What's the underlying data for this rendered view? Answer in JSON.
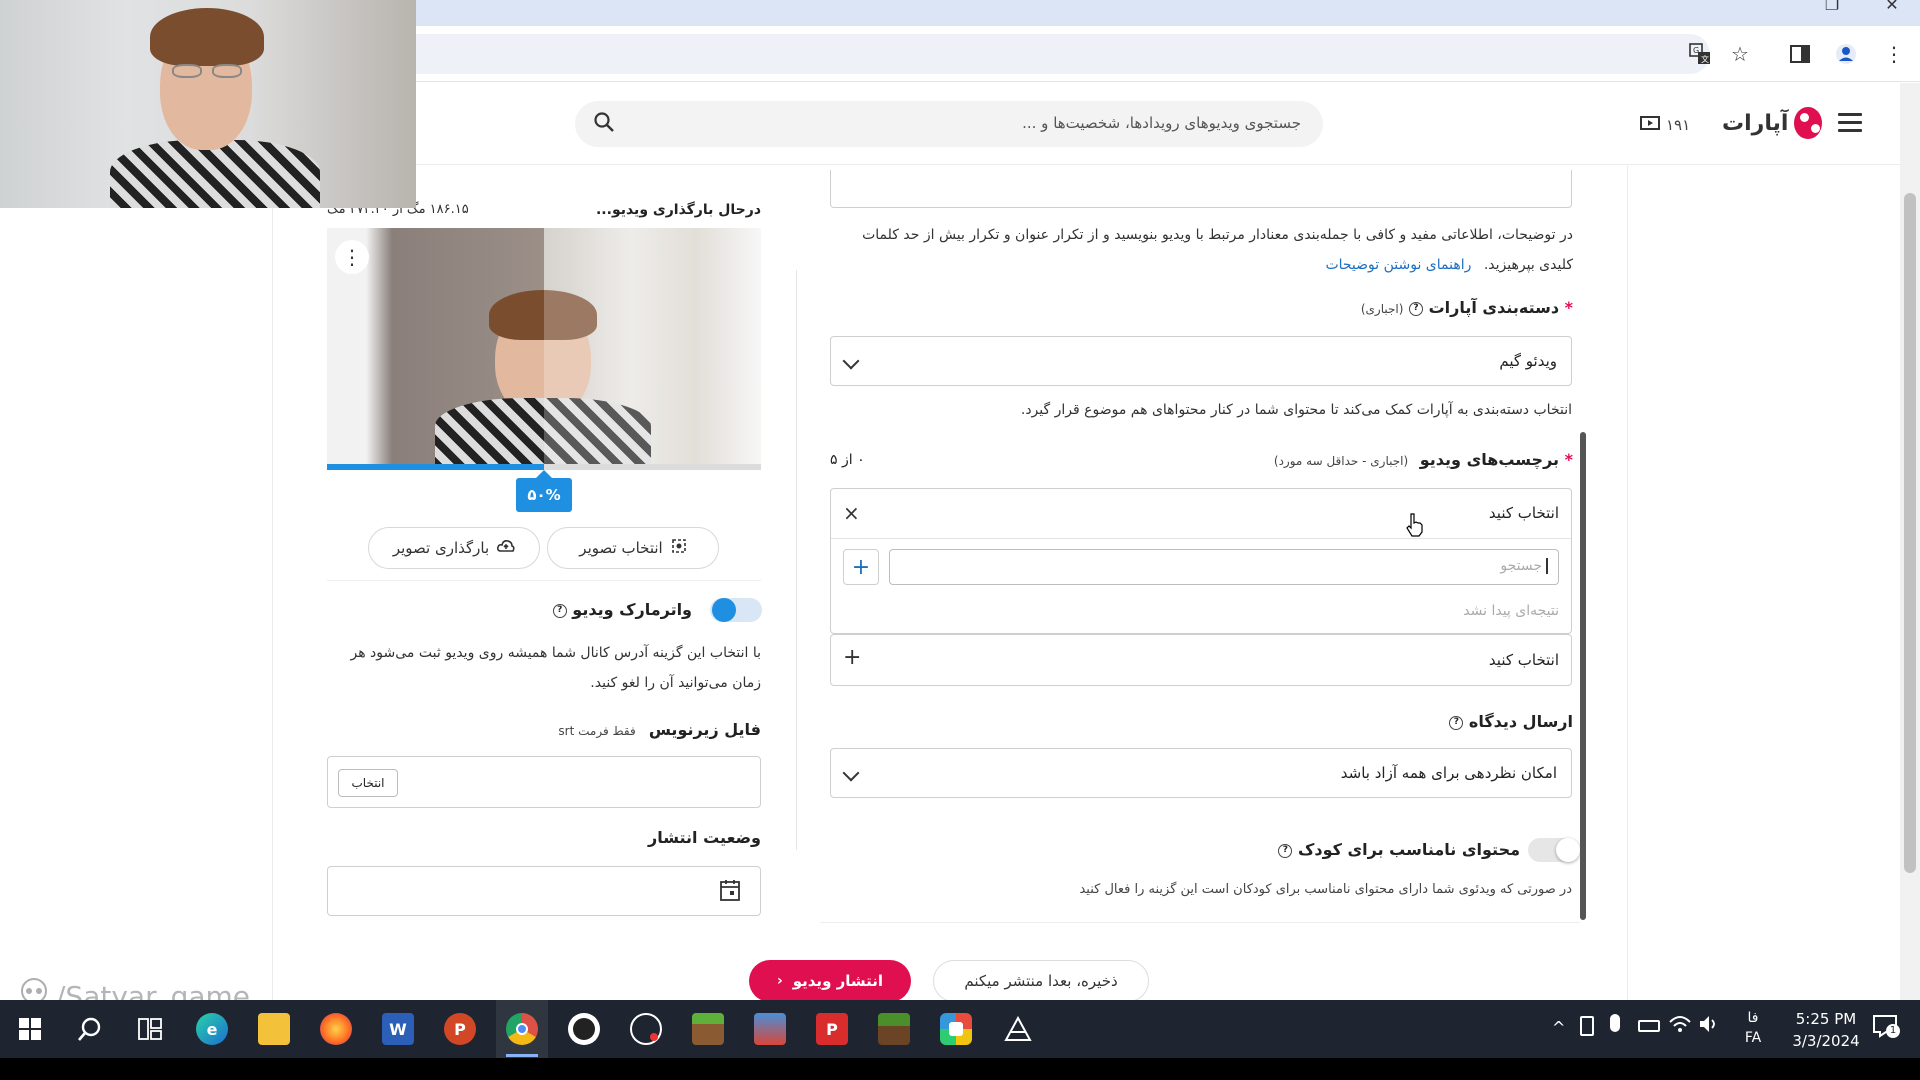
{
  "browser": {
    "icons": [
      "translate-icon",
      "bookmark-star-icon",
      "side-panel-icon",
      "profile-icon",
      "kebab-menu-icon"
    ]
  },
  "header": {
    "logo_text": "آپارات",
    "video_count": "۱۹۱",
    "search_placeholder": "جستجوی ویدیوهای رویدادها، شخصیت‌ها و ..."
  },
  "form": {
    "description_help": "در توضیحات، اطلاعاتی مفید و کافی با جمله‌بندی معنادار مرتبط با ویدیو بنویسید و از تکرار عنوان و تکرار بیش از حد کلمات کلیدی بپرهیزید.",
    "description_help_link": "راهنمای نوشتن توضیحات",
    "category": {
      "label": "دسته‌بندی آپارات",
      "required_note": "(اجباری)",
      "value": "ویدئو گیم",
      "help": "انتخاب دسته‌بندی به آپارات کمک می‌کند تا محتوای شما در کنار محتواهای هم موضوع قرار گیرد."
    },
    "tags": {
      "label": "برچسب‌های ویدیو",
      "required_note": "(اجباری - حداقل سه مورد)",
      "counter": "۰ از ۵",
      "select_placeholder": "انتخاب کنید",
      "search_placeholder": "جستجو",
      "no_result": "نتیجه‌ای پیدا نشد",
      "second_select": "انتخاب کنید"
    },
    "comments": {
      "label": "ارسال دیدگاه",
      "value": "امکان نظردهی برای همه آزاد باشد"
    },
    "kids": {
      "label": "محتوای نامناسب برای کودک",
      "help": "در صورتی که ویدئوی شما دارای محتوای نامناسب برای کودکان است این گزینه را فعال کنید"
    }
  },
  "upload": {
    "status": "درحال بارگذاری ویدیو...",
    "size": "۱۸۶.۱۵ مگ از ۳۷۲.۳۰ مگ",
    "progress": 0.5,
    "progress_label": "۵۰%",
    "select_image": "انتخاب تصویر",
    "upload_image": "بارگذاری تصویر",
    "watermark_label": "واترمارک ویدیو",
    "watermark_on": true,
    "watermark_help": "با انتخاب این گزینه آدرس کانال شما همیشه روی ویدیو ثبت می‌شود هر زمان می‌توانید آن را لغو کنید.",
    "subtitle_label": "فایل زیرنویس",
    "subtitle_note": "فقط فرمت srt",
    "subtitle_choose": "انتخاب",
    "publish_status_label": "وضعیت انتشار"
  },
  "actions": {
    "publish": "انتشار ویدیو",
    "save_later": "ذخیره، بعدا منتشر میکنم"
  },
  "watermark_overlay": "/Satyar_game",
  "taskbar": {
    "apps": [
      "windows-start-icon",
      "search-icon",
      "task-view-icon",
      "edge-icon",
      "file-explorer-icon",
      "firefox-icon",
      "word-icon",
      "powerpoint-icon",
      "chrome-icon",
      "obs-icon",
      "clipchamp-icon",
      "minecraft-icon",
      "car-game-icon",
      "papers-icon",
      "minecraft-launcher-icon",
      "photos-icon",
      "arduino-icon"
    ],
    "lang_top": "فا",
    "lang_bottom": "FA",
    "time": "5:25 PM",
    "date": "3/3/2024",
    "notifications": "1"
  },
  "colors": {
    "brand": "#df0f50",
    "accent_blue": "#1e8fe1",
    "progress_blue": "#1e8fe1"
  }
}
